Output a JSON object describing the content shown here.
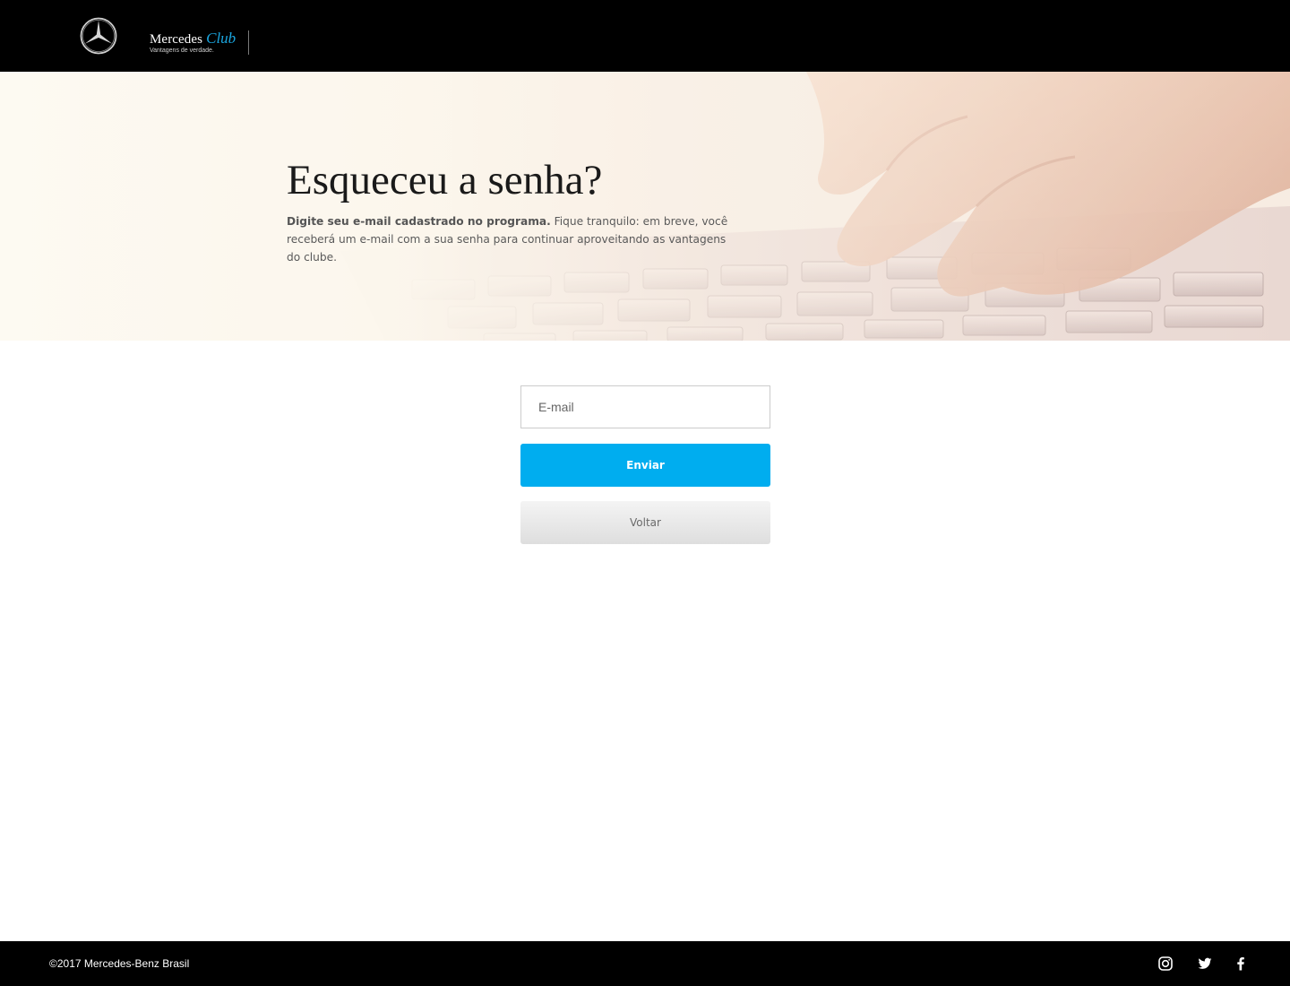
{
  "header": {
    "brand_name": "Mercedes",
    "brand_club": "Club",
    "brand_tagline": "Vantagens de verdade.",
    "logo_icon": "mercedes-star-icon"
  },
  "hero": {
    "title": "Esqueceu a senha?",
    "description_bold": "Digite seu e-mail cadastrado no programa.",
    "description_rest": " Fique tranquilo: em breve, você receberá um e-mail com a sua senha para continuar aproveitando as vantagens do clube.",
    "background_image": "hand-typing-on-keyboard"
  },
  "form": {
    "email_placeholder": "E-mail",
    "email_value": "",
    "send_label": "Enviar",
    "back_label": "Voltar"
  },
  "footer": {
    "copyright": "©2017 Mercedes-Benz Brasil",
    "social_icons": [
      "instagram-icon",
      "twitter-icon",
      "facebook-icon"
    ]
  },
  "colors": {
    "accent": "#00adef",
    "club_blue": "#1aa6e0",
    "header_bg": "#000000",
    "footer_bg": "#000000"
  }
}
